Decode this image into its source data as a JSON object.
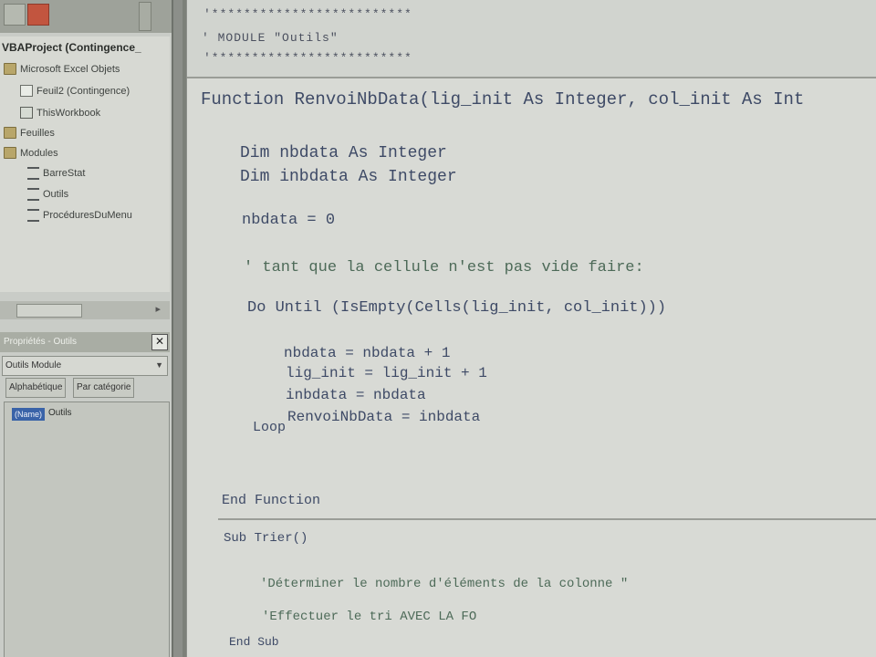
{
  "project": {
    "root_label": "VBAProject (Contingence_",
    "nodes": [
      {
        "label": "Microsoft Excel Objets"
      },
      {
        "label": "Feuil2 (Contingence)"
      },
      {
        "label": "ThisWorkbook"
      },
      {
        "label": "Feuilles"
      },
      {
        "label": "Modules"
      },
      {
        "label": "BarreStat"
      },
      {
        "label": "Outils"
      },
      {
        "label": "ProcéduresDuMenu"
      }
    ]
  },
  "properties": {
    "title": "Propriétés - Outils",
    "close_label": "✕",
    "object_combo": "Outils Module",
    "tabs": [
      "Alphabétique",
      "Par catégorie"
    ],
    "prop_name": "(Name)",
    "prop_value": "Outils"
  },
  "code": {
    "header_stars_top": "'*************************",
    "header_title": "' MODULE \"Outils\"",
    "header_stars_bottom": "'*************************",
    "lines": [
      "Function RenvoiNbData(lig_init As Integer, col_init As Int",
      "Dim nbdata As Integer",
      "Dim inbdata As Integer",
      "nbdata = 0",
      "' tant que la cellule n'est pas vide faire:",
      "Do Until (IsEmpty(Cells(lig_init, col_init)))",
      "nbdata = nbdata + 1",
      "lig_init = lig_init + 1",
      "inbdata = nbdata",
      "RenvoiNbData = inbdata",
      "Loop",
      "End Function",
      "Sub Trier()",
      "'Déterminer le nombre d'éléments de la colonne \"",
      "'Effectuer le tri AVEC LA FO",
      "End Sub"
    ]
  },
  "colors": {
    "code_text": "#3e4a66",
    "comment": "#4d6a58",
    "selection": "#3a63a8"
  }
}
